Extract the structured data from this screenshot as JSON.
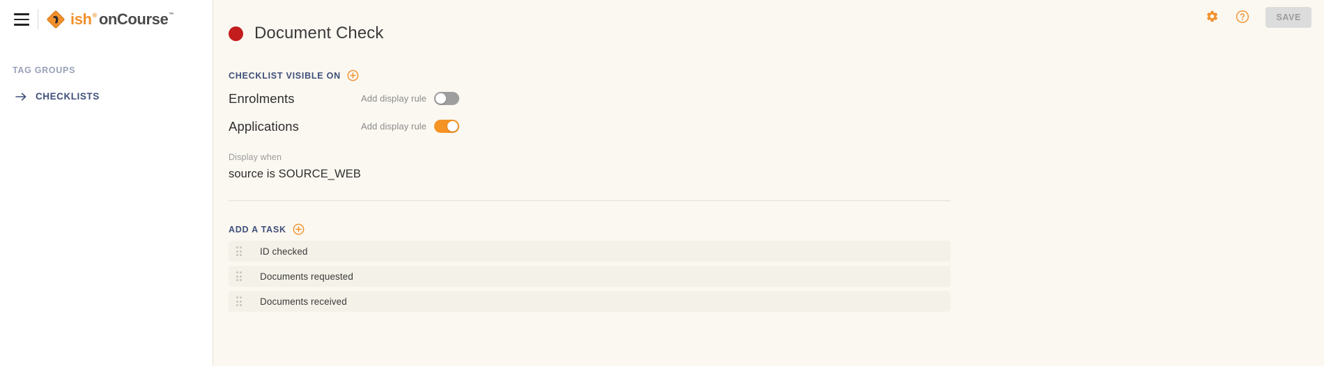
{
  "app": {
    "logo_primary": "ish",
    "logo_superscript": "®",
    "logo_secondary": "onCourse",
    "logo_trademark": "™",
    "accent_orange": "#f2902c",
    "nav_blue": "#3f4f7a",
    "status_red": "#c31d1d"
  },
  "sidebar": {
    "menu_icon": "hamburger-icon",
    "section_label": "TAG GROUPS",
    "items": [
      {
        "label": "CHECKLISTS",
        "icon": "arrow-right-icon"
      }
    ]
  },
  "topbar": {
    "settings_icon": "gear-icon",
    "help_icon": "help-circle-icon",
    "save_label": "SAVE"
  },
  "page": {
    "title": "Document Check",
    "status_dot": "red-status-dot"
  },
  "visibility_section": {
    "heading": "CHECKLIST VISIBLE ON",
    "add_icon": "plus-circle-icon",
    "rules": [
      {
        "name": "Enrolments",
        "toggle_label": "Add display rule",
        "enabled": false
      },
      {
        "name": "Applications",
        "toggle_label": "Add display rule",
        "enabled": true
      }
    ],
    "display_when": {
      "label": "Display when",
      "value": "source is SOURCE_WEB"
    }
  },
  "tasks_section": {
    "heading": "ADD A TASK",
    "add_icon": "plus-circle-icon",
    "tasks": [
      {
        "label": "ID checked"
      },
      {
        "label": "Documents requested"
      },
      {
        "label": "Documents received"
      }
    ]
  }
}
